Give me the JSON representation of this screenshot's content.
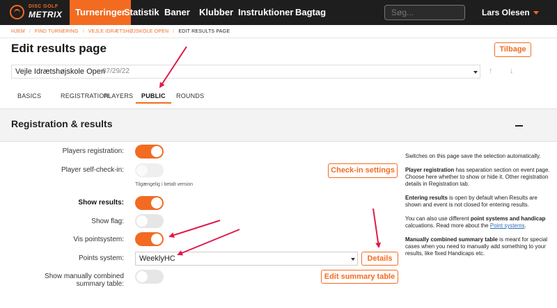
{
  "nav": {
    "logo_small": "DISC GOLF",
    "logo_big": "METRIX",
    "items": [
      "Turneringer",
      "Statistik",
      "Baner",
      "Klubber",
      "Instruktioner",
      "Bagtag"
    ],
    "search_placeholder": "Søg...",
    "user": "Lars Olesen"
  },
  "breadcrumb": [
    "HJEM",
    "FIND TURNERING",
    "VEJLE IDRÆTSHØJSKOLE OPEN",
    "EDIT RESULTS PAGE"
  ],
  "page": {
    "title": "Edit results page",
    "back_button": "Tilbage",
    "event_name": "Vejle Idrætshøjskole Open",
    "event_date": "07/29/22"
  },
  "tabs": [
    "BASICS",
    "REGISTRATION",
    "PLAYERS",
    "PUBLIC",
    "ROUNDS"
  ],
  "active_tab": "PUBLIC",
  "section": {
    "title": "Registration & results"
  },
  "form": {
    "players_registration": {
      "label": "Players registration:",
      "on": true
    },
    "self_checkin": {
      "label": "Player self-check-in:",
      "on": false,
      "disabled": true,
      "hint": "Tilgængelig i betalt version"
    },
    "checkin_button": "Check-in settings",
    "show_results": {
      "label": "Show results:",
      "on": true
    },
    "show_flag": {
      "label": "Show flag:",
      "on": false
    },
    "vis_pointsystem": {
      "label": "Vis pointsystem:",
      "on": true
    },
    "points_system": {
      "label": "Points system:",
      "value": "WeeklyHC"
    },
    "details_button": "Details",
    "manual_summary": {
      "label_line1": "Show manually combined",
      "label_line2": "summary table:",
      "on": false
    },
    "summary_button": "Edit summary table"
  },
  "sidebar": {
    "p1": "Switches on this page save the selection automatically.",
    "p2_bold": "Player registration",
    "p2_rest": " has separation section on event page. Choose here whether to show or hide it. Other registration details in Registration tab.",
    "p3_bold": "Entering results",
    "p3_rest": " is open by default when Results are shown and event is not closed for entering results.",
    "p4_a": "You can also use different ",
    "p4_bold": "point systems and handicap",
    "p4_b": " calcuations. Read more about the ",
    "p4_link": "Point systems",
    "p4_c": ".",
    "p5_bold": "Manually combined summary table",
    "p5_rest": " is meant for special cases when you need to manually add something to your results, like fixed Handicaps etc."
  },
  "colors": {
    "accent": "#f26b21",
    "nav_bg": "#1e1e1e",
    "annotation_arrow": "#e0194a"
  }
}
